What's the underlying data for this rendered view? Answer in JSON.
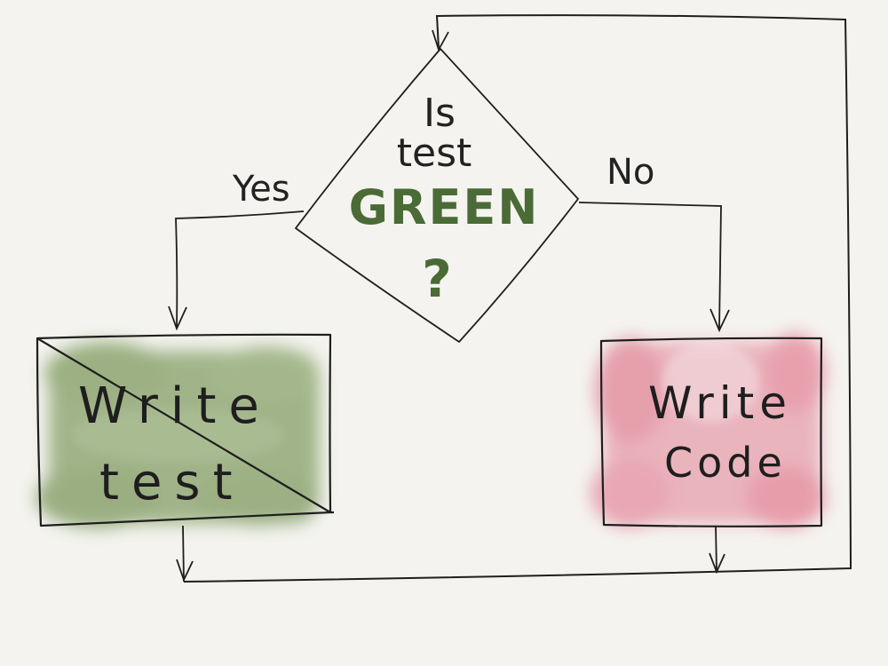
{
  "decision": {
    "line1": "Is",
    "line2": "test",
    "line3": "GREEN",
    "line4": "?"
  },
  "branches": {
    "yes_label": "Yes",
    "no_label": "No"
  },
  "boxes": {
    "write_test": {
      "line1": "Write",
      "line2": "test",
      "fill_color": "#7e9a5e"
    },
    "write_code": {
      "line1": "Write",
      "line2": "Code",
      "fill_color": "#e07d90"
    }
  },
  "colors": {
    "background": "#f4f3ef",
    "ink": "#1e1e1e",
    "green_accent": "#4a6b36"
  }
}
